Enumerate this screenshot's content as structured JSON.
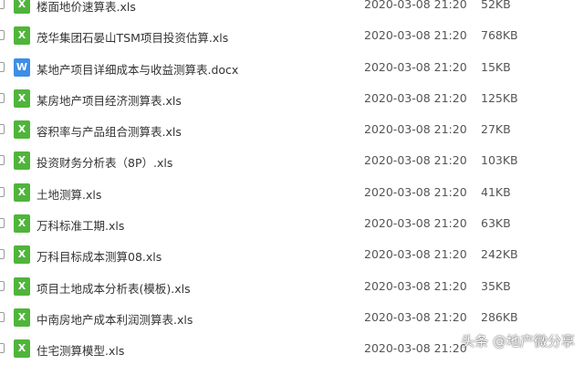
{
  "colors": {
    "excel_icon": "#4fb53a",
    "word_icon": "#3d8fe6"
  },
  "files": [
    {
      "name": "楼面地价速算表.xls",
      "date": "2020-03-08 21:20",
      "size": "52KB",
      "type": "xls",
      "icon_letter": "X"
    },
    {
      "name": "茂华集团石晏山TSM项目投资估算.xls",
      "date": "2020-03-08 21:20",
      "size": "768KB",
      "type": "xls",
      "icon_letter": "X"
    },
    {
      "name": "某地产项目详细成本与收益测算表.docx",
      "date": "2020-03-08 21:20",
      "size": "15KB",
      "type": "doc",
      "icon_letter": "W"
    },
    {
      "name": "某房地产项目经济测算表.xls",
      "date": "2020-03-08 21:20",
      "size": "125KB",
      "type": "xls",
      "icon_letter": "X"
    },
    {
      "name": "容积率与产品组合测算表.xls",
      "date": "2020-03-08 21:20",
      "size": "27KB",
      "type": "xls",
      "icon_letter": "X"
    },
    {
      "name": "投资财务分析表（8P）.xls",
      "date": "2020-03-08 21:20",
      "size": "103KB",
      "type": "xls",
      "icon_letter": "X"
    },
    {
      "name": "土地测算.xls",
      "date": "2020-03-08 21:20",
      "size": "41KB",
      "type": "xls",
      "icon_letter": "X"
    },
    {
      "name": "万科标准工期.xls",
      "date": "2020-03-08 21:20",
      "size": "63KB",
      "type": "xls",
      "icon_letter": "X"
    },
    {
      "name": "万科目标成本测算08.xls",
      "date": "2020-03-08 21:20",
      "size": "242KB",
      "type": "xls",
      "icon_letter": "X"
    },
    {
      "name": "项目土地成本分析表(模板).xls",
      "date": "2020-03-08 21:20",
      "size": "35KB",
      "type": "xls",
      "icon_letter": "X"
    },
    {
      "name": "中南房地产成本利润测算表.xls",
      "date": "2020-03-08 21:20",
      "size": "286KB",
      "type": "xls",
      "icon_letter": "X"
    },
    {
      "name": "住宅测算模型.xls",
      "date": "2020-03-08 21:20",
      "size": "",
      "type": "xls",
      "icon_letter": "X"
    }
  ],
  "watermark": "头条 @地产微分享"
}
